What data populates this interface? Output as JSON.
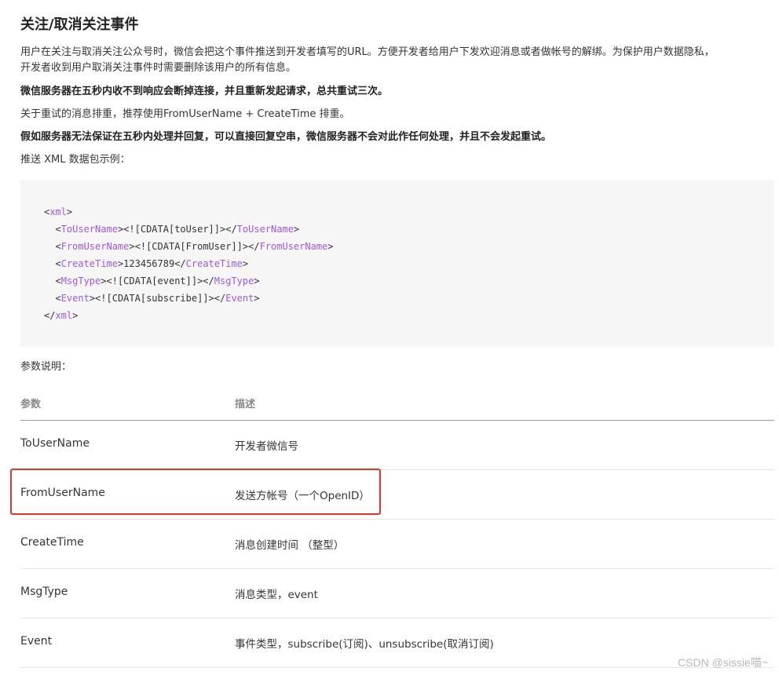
{
  "doc": {
    "title": "关注/取消关注事件",
    "intro_line1": "用户在关注与取消关注公众号时，微信会把这个事件推送到开发者填写的URL。方便开发者给用户下发欢迎消息或者做帐号的解绑。为保护用户数据隐私，",
    "intro_line2": "开发者收到用户取消关注事件时需要删除该用户的所有信息。",
    "bold_retry": "微信服务器在五秒内收不到响应会断掉连接，并且重新发起请求，总共重试三次。",
    "dedupe_note": "关于重试的消息排重，推荐使用FromUserName + CreateTime 排重。",
    "bold_noretry": "假如服务器无法保证在五秒内处理并回复，可以直接回复空串，微信服务器不会对此作任何处理，并且不会发起重试。",
    "xml_example_label": "推送 XML 数据包示例：",
    "params_label": "参数说明："
  },
  "code": {
    "lines": [
      {
        "indent": "",
        "tag": "xml",
        "content": "",
        "close": "",
        "kind": "open"
      },
      {
        "indent": "  ",
        "tag": "ToUserName",
        "content": "<![CDATA[toUser]]>",
        "close": "ToUserName",
        "kind": "full"
      },
      {
        "indent": "  ",
        "tag": "FromUserName",
        "content": "<![CDATA[FromUser]]>",
        "close": "FromUserName",
        "kind": "full"
      },
      {
        "indent": "  ",
        "tag": "CreateTime",
        "content": "123456789",
        "close": "CreateTime",
        "kind": "full"
      },
      {
        "indent": "  ",
        "tag": "MsgType",
        "content": "<![CDATA[event]]>",
        "close": "MsgType",
        "kind": "full"
      },
      {
        "indent": "  ",
        "tag": "Event",
        "content": "<![CDATA[subscribe]]>",
        "close": "Event",
        "kind": "full"
      },
      {
        "indent": "",
        "tag": "xml",
        "content": "",
        "close": "",
        "kind": "close"
      }
    ]
  },
  "table": {
    "headers": {
      "param": "参数",
      "desc": "描述"
    },
    "rows": [
      {
        "param": "ToUserName",
        "desc": "开发者微信号"
      },
      {
        "param": "FromUserName",
        "desc": "发送方帐号（一个OpenID）"
      },
      {
        "param": "CreateTime",
        "desc": "消息创建时间 （整型）"
      },
      {
        "param": "MsgType",
        "desc": "消息类型，event"
      },
      {
        "param": "Event",
        "desc": "事件类型，subscribe(订阅)、unsubscribe(取消订阅)"
      }
    ]
  },
  "watermark": "CSDN @sissie喵~",
  "colors": {
    "highlight_box": "#e8322b",
    "xml_tag": "#a057e6",
    "code_background": "#f6f6f6"
  }
}
